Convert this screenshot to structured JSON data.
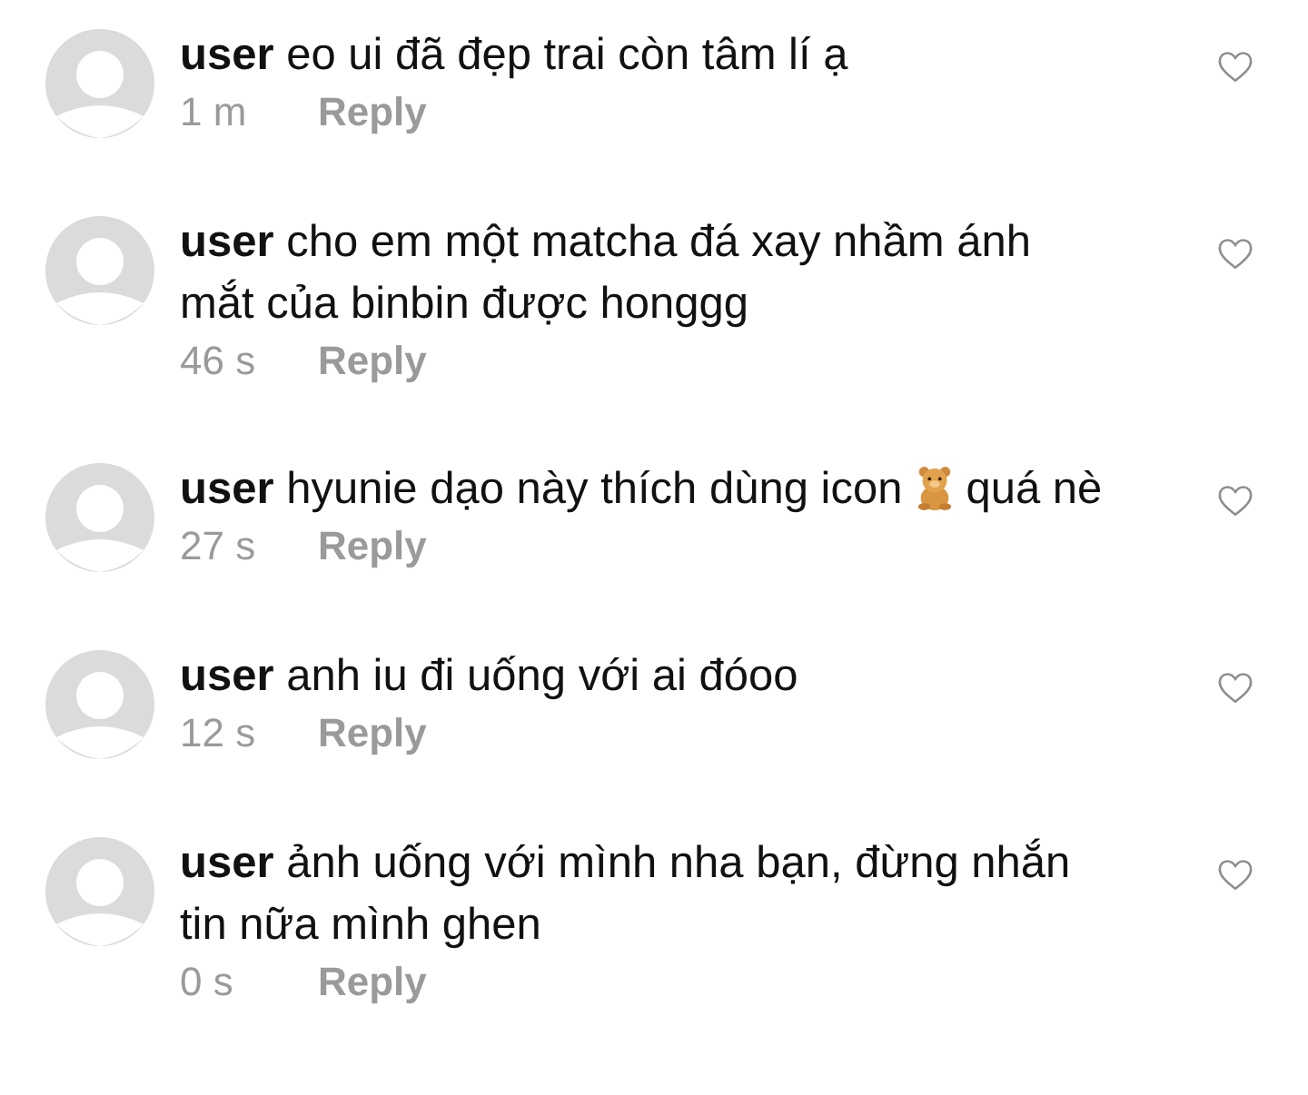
{
  "comments": [
    {
      "parts": [
        {
          "kind": "text",
          "text": "**user** eo ui đã đẹp trai còn tâm lí ạ"
        }
      ],
      "time": "1 m",
      "reply": "Reply",
      "liked": false
    },
    {
      "parts": [
        {
          "kind": "text",
          "text": "**user** cho em một matcha đá xay nhầm ánh mắt của binbin được honggg"
        }
      ],
      "time": "46 s",
      "reply": "Reply",
      "liked": false
    },
    {
      "parts": [
        {
          "kind": "text",
          "text": "**user** hyunie dạo này thích dùng icon"
        },
        {
          "kind": "emoji"
        },
        {
          "kind": "text",
          "text": "quá nè"
        }
      ],
      "time": "27 s",
      "reply": "Reply",
      "liked": false
    },
    {
      "parts": [
        {
          "kind": "text",
          "text": "**user** anh iu đi uống với ai đóoo"
        }
      ],
      "time": "12 s",
      "reply": "Reply",
      "liked": false
    },
    {
      "parts": [
        {
          "kind": "text",
          "text": "**user** ảnh uống với mình nha bạn, đừng nhắn tin nữa mình ghen"
        }
      ],
      "time": "0 s",
      "reply": "Reply",
      "liked": false
    }
  ]
}
